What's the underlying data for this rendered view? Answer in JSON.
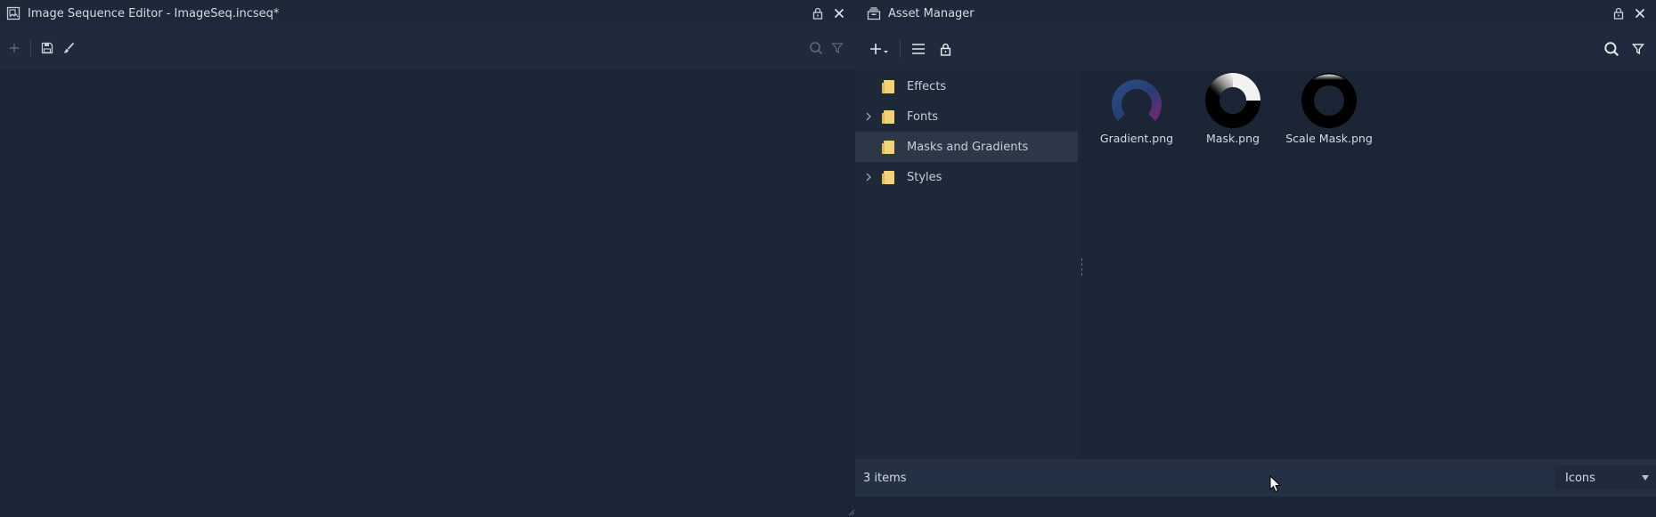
{
  "left_panel": {
    "title": "Image Sequence Editor - ImageSeq.incseq*",
    "icons": {
      "title": "image-sequence-icon",
      "lock": "lock-icon",
      "close": "close-icon",
      "add": "plus-icon",
      "save": "save-icon",
      "brush": "brush-icon",
      "search": "search-icon",
      "filter": "filter-icon"
    }
  },
  "right_panel": {
    "title": "Asset Manager",
    "icons": {
      "title": "asset-manager-icon",
      "lock": "lock-icon",
      "close": "close-icon",
      "add": "plus-dropdown-icon",
      "list": "list-icon",
      "toolbar_lock": "lock-icon",
      "search": "search-icon",
      "filter": "filter-icon"
    },
    "tree": [
      {
        "label": "Effects",
        "expandable": false,
        "selected": false
      },
      {
        "label": "Fonts",
        "expandable": true,
        "selected": false
      },
      {
        "label": "Masks and Gradients",
        "expandable": false,
        "selected": true
      },
      {
        "label": "Styles",
        "expandable": true,
        "selected": false
      }
    ],
    "assets": [
      {
        "name": "Gradient.png",
        "thumb": "gradient-ring-thumbnail"
      },
      {
        "name": "Mask.png",
        "thumb": "mask-ring-thumbnail"
      },
      {
        "name": "Scale Mask.png",
        "thumb": "scale-mask-ring-thumbnail"
      }
    ],
    "status": {
      "count": "3 items",
      "view_mode": "Icons"
    }
  },
  "colors": {
    "background": "#1b2535",
    "panel": "#1e2839",
    "toolbar": "#1f2a3c",
    "selected": "#2c3748",
    "statusbar": "#243044",
    "folder": "#f3d37a",
    "text": "#c9ced6"
  }
}
